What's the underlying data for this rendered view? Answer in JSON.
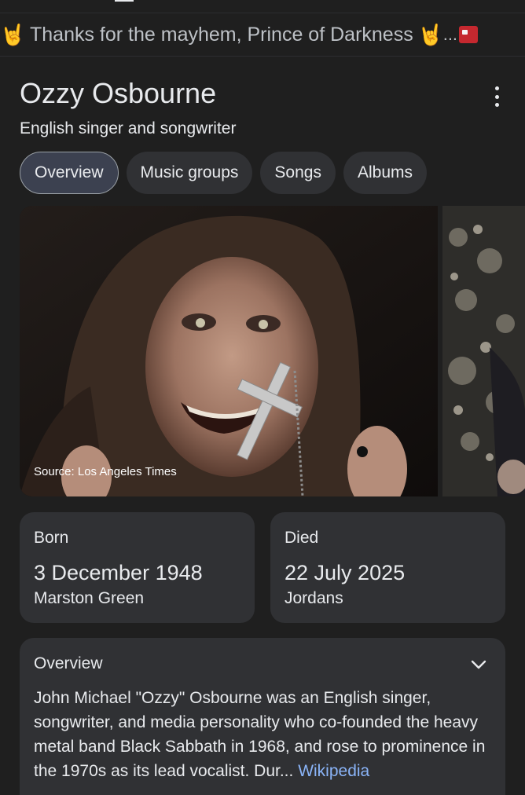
{
  "banner": {
    "emoji_left": "🤘",
    "text": "Thanks for the mayhem, Prince of Darkness",
    "emoji_right": "🤘",
    "ellipsis": "..."
  },
  "entity": {
    "name": "Ozzy Osbourne",
    "description": "English singer and songwriter"
  },
  "tabs": [
    {
      "label": "Overview",
      "active": true
    },
    {
      "label": "Music groups",
      "active": false
    },
    {
      "label": "Songs",
      "active": false
    },
    {
      "label": "Albums",
      "active": false
    }
  ],
  "images": {
    "source": "Source: Los Angeles Times"
  },
  "facts": {
    "born": {
      "label": "Born",
      "value": "3 December 1948",
      "place": "Marston Green"
    },
    "died": {
      "label": "Died",
      "value": "22 July 2025",
      "place": "Jordans"
    }
  },
  "overview": {
    "heading": "Overview",
    "text": "John Michael \"Ozzy\" Osbourne was an English singer, songwriter, and media personality who co-founded the heavy metal band Black Sabbath in 1968, and rose to prominence in the 1970s as its lead vocalist. Dur...",
    "link": "Wikipedia"
  },
  "colors": {
    "background": "#1f1f1f",
    "card": "#303134",
    "active_chip": "#3c4150",
    "link": "#8ab4f8",
    "text": "#e8eaed"
  }
}
